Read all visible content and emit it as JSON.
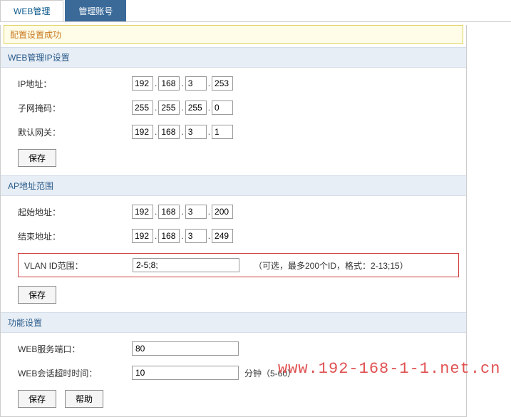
{
  "tabs": {
    "active": "WEB管理",
    "inactive": "管理账号"
  },
  "success": "配置设置成功",
  "section1": {
    "title": "WEB管理IP设置",
    "ip_label": "IP地址：",
    "ip": [
      "192",
      "168",
      "3",
      "253"
    ],
    "mask_label": "子网掩码：",
    "mask": [
      "255",
      "255",
      "255",
      "0"
    ],
    "gw_label": "默认网关：",
    "gw": [
      "192",
      "168",
      "3",
      "1"
    ],
    "save": "保存"
  },
  "section2": {
    "title": "AP地址范围",
    "start_label": "起始地址：",
    "start": [
      "192",
      "168",
      "3",
      "200"
    ],
    "end_label": "结束地址：",
    "end": [
      "192",
      "168",
      "3",
      "249"
    ],
    "vlan_label": "VLAN ID范围：",
    "vlan_value": "2-5;8;",
    "vlan_hint": "（可选，最多200个ID，格式：2-13;15）",
    "save": "保存"
  },
  "section3": {
    "title": "功能设置",
    "port_label": "WEB服务端口：",
    "port_value": "80",
    "timeout_label": "WEB会话超时时间：",
    "timeout_value": "10",
    "timeout_hint": "分钟（5-60）",
    "save": "保存",
    "help": "帮助"
  },
  "watermark": "www.192-168-1-1.net.cn"
}
